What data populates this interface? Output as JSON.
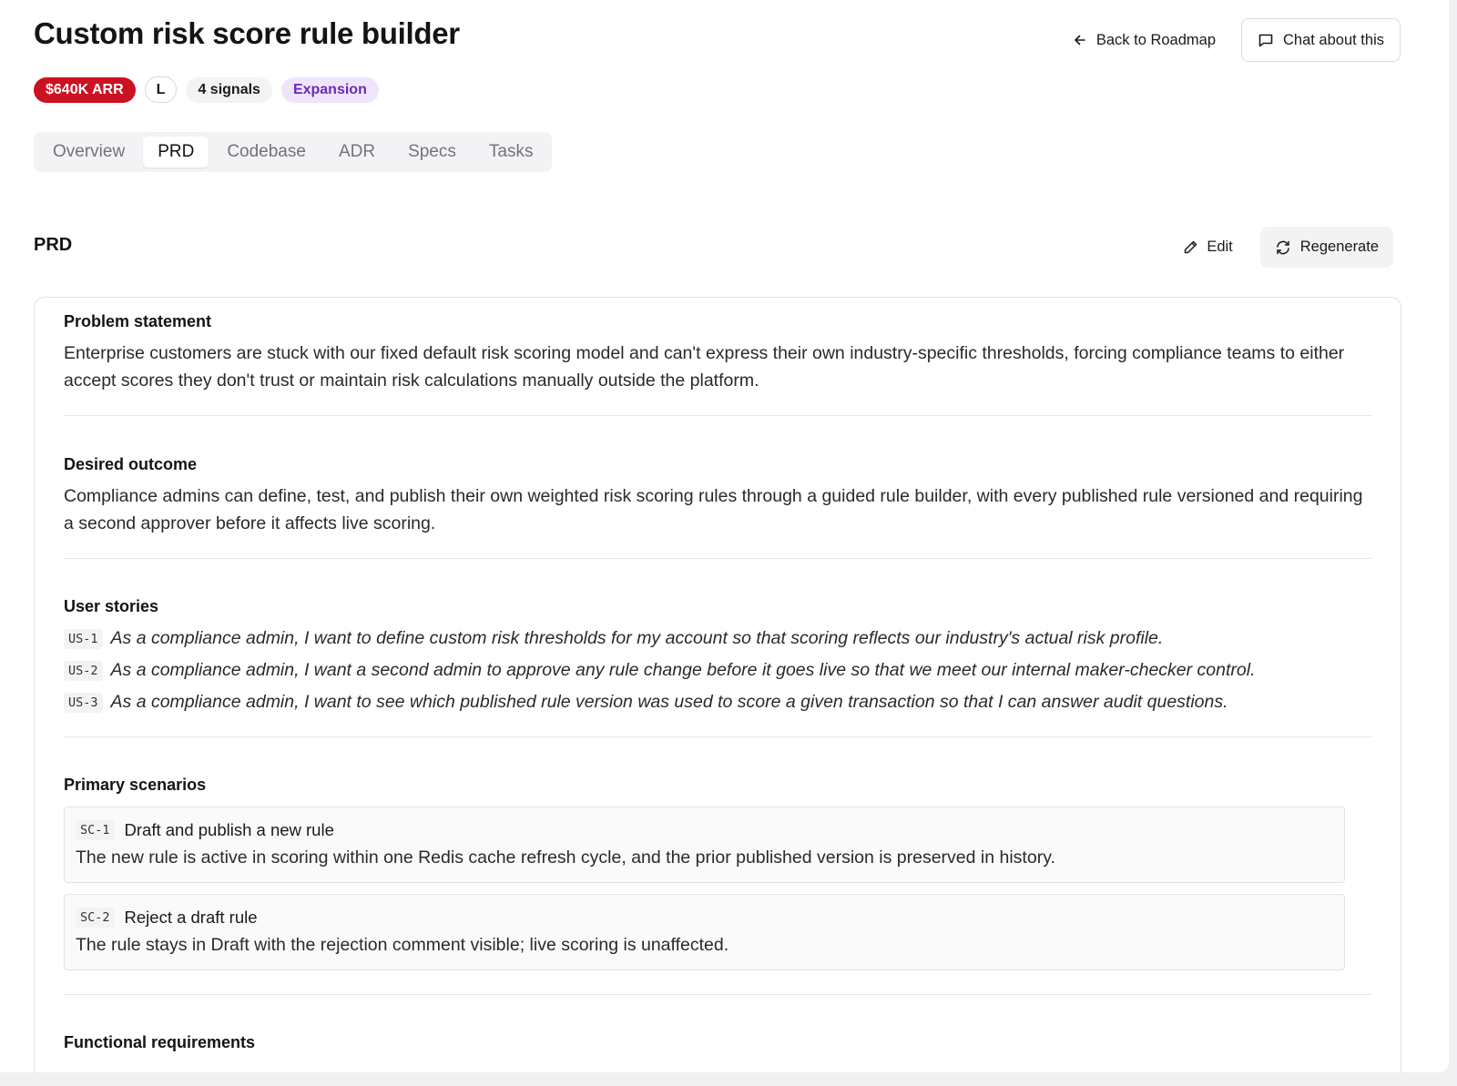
{
  "header": {
    "title": "Custom risk score rule builder",
    "back_label": "Back to Roadmap",
    "chat_label": "Chat about this"
  },
  "badges": {
    "arr": "$640K ARR",
    "size": "L",
    "signals": "4 signals",
    "category": "Expansion"
  },
  "tabs": [
    "Overview",
    "PRD",
    "Codebase",
    "ADR",
    "Specs",
    "Tasks"
  ],
  "active_tab": "PRD",
  "section": {
    "title": "PRD",
    "edit_label": "Edit",
    "regenerate_label": "Regenerate"
  },
  "prd": {
    "problem": {
      "heading": "Problem statement",
      "text": "Enterprise customers are stuck with our fixed default risk scoring model and can't express their own industry-specific thresholds, forcing compliance teams to either accept scores they don't trust or maintain risk calculations manually outside the platform."
    },
    "outcome": {
      "heading": "Desired outcome",
      "text": "Compliance admins can define, test, and publish their own weighted risk scoring rules through a guided rule builder, with every published rule versioned and requiring a second approver before it affects live scoring."
    },
    "stories": {
      "heading": "User stories",
      "items": [
        {
          "id": "US-1",
          "text": "As a compliance admin, I want to define custom risk thresholds for my account so that scoring reflects our industry's actual risk profile."
        },
        {
          "id": "US-2",
          "text": "As a compliance admin, I want a second admin to approve any rule change before it goes live so that we meet our internal maker-checker control."
        },
        {
          "id": "US-3",
          "text": "As a compliance admin, I want to see which published rule version was used to score a given transaction so that I can answer audit questions."
        }
      ]
    },
    "scenarios": {
      "heading": "Primary scenarios",
      "items": [
        {
          "id": "SC-1",
          "title": "Draft and publish a new rule",
          "text": "The new rule is active in scoring within one Redis cache refresh cycle, and the prior published version is preserved in history."
        },
        {
          "id": "SC-2",
          "title": "Reject a draft rule",
          "text": "The rule stays in Draft with the rejection comment visible; live scoring is unaffected."
        }
      ]
    },
    "functional": {
      "heading": "Functional requirements"
    }
  },
  "icons": {
    "back": "arrow-left-icon",
    "chat": "chat-bubble-icon",
    "edit": "pencil-icon",
    "regenerate": "refresh-icon"
  },
  "colors": {
    "arr_badge": "#cc1122",
    "expansion_badge_bg": "#efe5fb",
    "expansion_badge_text": "#6b2bb5"
  }
}
